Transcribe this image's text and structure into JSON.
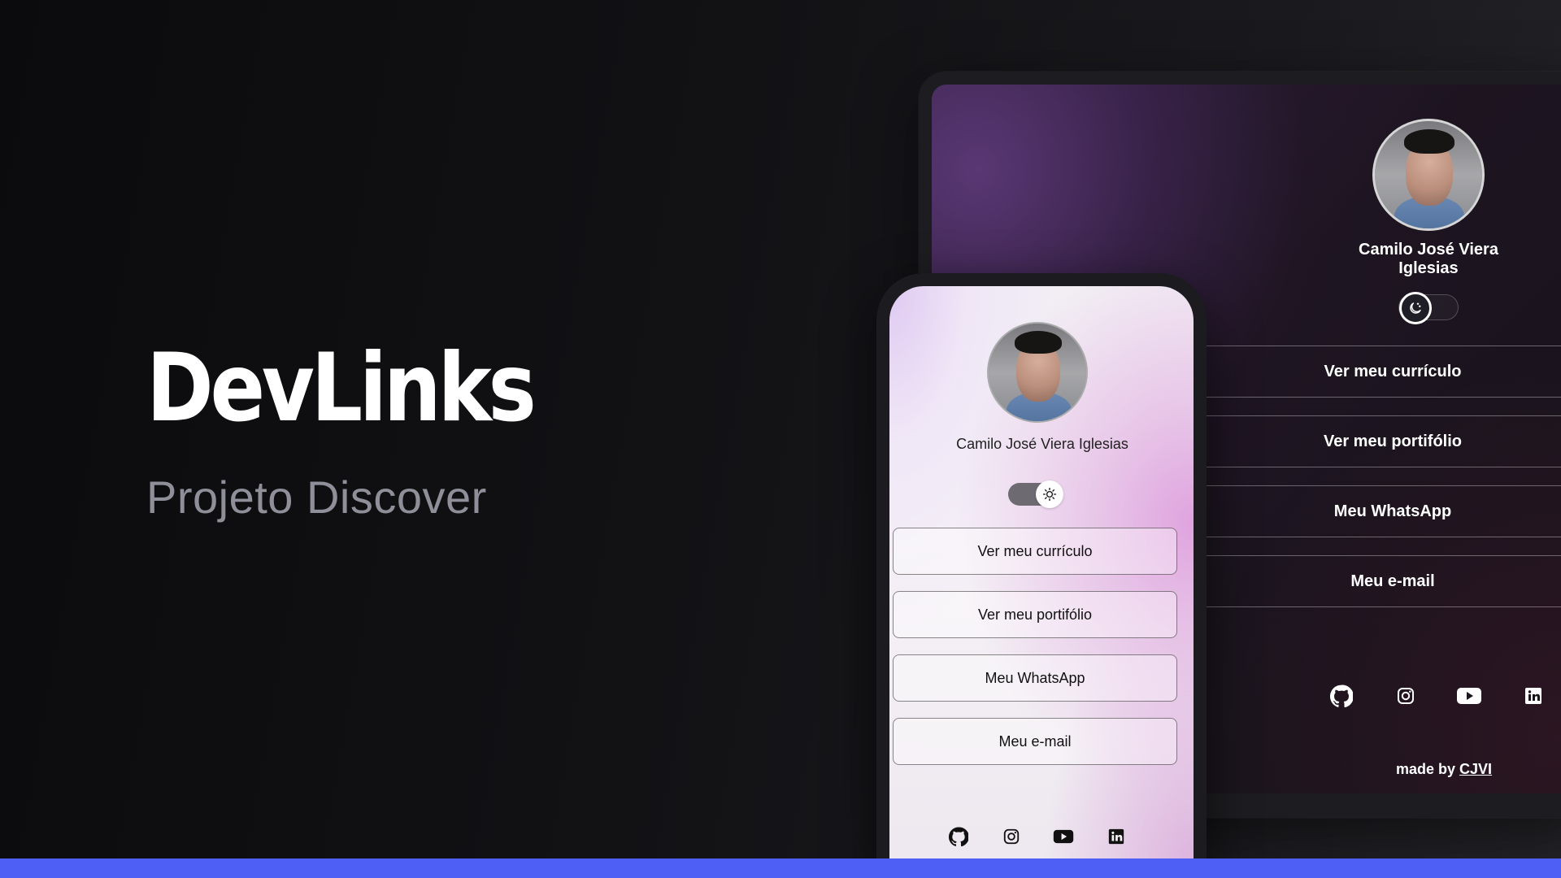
{
  "hero": {
    "title": "DevLinks",
    "subtitle": "Projeto Discover"
  },
  "desktop": {
    "name": "Camilo José Viera Iglesias",
    "links": [
      {
        "label": "Ver meu currículo"
      },
      {
        "label": "Ver meu portifólio"
      },
      {
        "label": "Meu WhatsApp"
      },
      {
        "label": "Meu e-mail"
      }
    ],
    "footer": {
      "prefix": "made by",
      "link": "CJVI"
    },
    "toggle_icon": "moon-icon",
    "social": [
      "github-icon",
      "instagram-icon",
      "youtube-icon",
      "linkedin-icon"
    ]
  },
  "mobile": {
    "name": "Camilo José Viera Iglesias",
    "links": [
      {
        "label": "Ver meu currículo"
      },
      {
        "label": "Ver meu portifólio"
      },
      {
        "label": "Meu WhatsApp"
      },
      {
        "label": "Meu e-mail"
      }
    ],
    "toggle_icon": "sun-icon",
    "social": [
      "github-icon",
      "instagram-icon",
      "youtube-icon",
      "linkedin-icon"
    ]
  },
  "colors": {
    "accent": "#4d5ff5",
    "background": "#0f0f11",
    "subtitle": "#8f8f99"
  }
}
